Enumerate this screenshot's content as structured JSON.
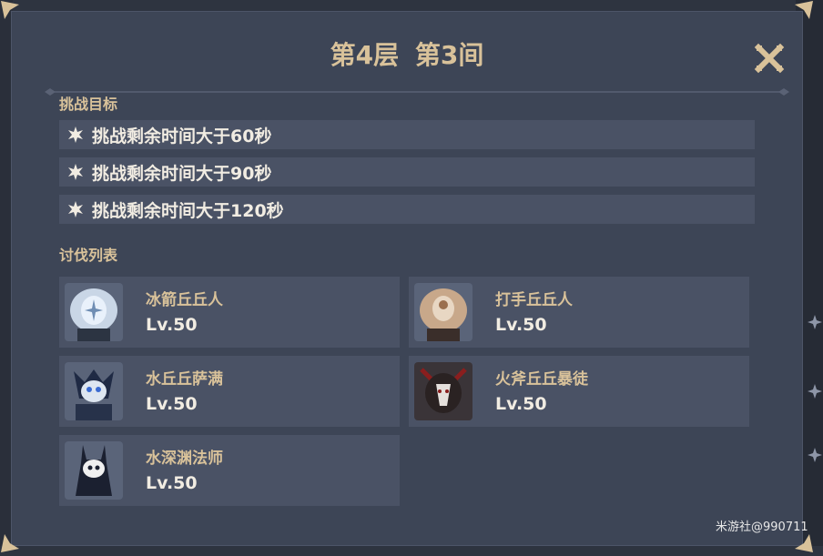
{
  "header": {
    "title_floor": "第4层",
    "title_room": "第3间"
  },
  "goals_section": {
    "label": "挑战目标",
    "items": [
      {
        "text": "挑战剩余时间大于60秒"
      },
      {
        "text": "挑战剩余时间大于90秒"
      },
      {
        "text": "挑战剩余时间大于120秒"
      }
    ]
  },
  "enemies_section": {
    "label": "讨伐列表",
    "items": [
      {
        "name": "冰箭丘丘人",
        "level": "Lv.50",
        "icon": "ice-archer-hilichurl-icon"
      },
      {
        "name": "打手丘丘人",
        "level": "Lv.50",
        "icon": "hilichurl-fighter-icon"
      },
      {
        "name": "水丘丘萨满",
        "level": "Lv.50",
        "icon": "hydro-samachurl-icon"
      },
      {
        "name": "火斧丘丘暴徒",
        "level": "Lv.50",
        "icon": "blazing-axe-mitachurl-icon"
      },
      {
        "name": "水深渊法师",
        "level": "Lv.50",
        "icon": "hydro-abyss-mage-icon"
      }
    ]
  },
  "watermark": "米游社@990711",
  "colors": {
    "panel_bg": "#3d4556",
    "row_bg": "#4a5265",
    "gold": "#d9c29a",
    "text": "#f1ece2"
  }
}
